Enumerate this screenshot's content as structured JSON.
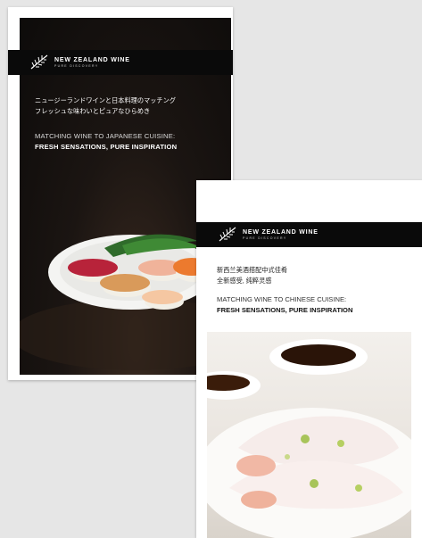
{
  "brand": {
    "name": "NEW ZEALAND WINE",
    "tagline": "PURE DISCOVERY"
  },
  "japanese_brochure": {
    "headline_jp_line1": "ニュージーランドワインと日本料理のマッチング",
    "headline_jp_line2": "フレッシュな味わいとピュアなひらめき",
    "title_line1": "MATCHING WINE TO JAPANESE CUISINE:",
    "title_line2": "FRESH SENSATIONS, PURE INSPIRATION",
    "image_subject": "sushi-plate"
  },
  "chinese_brochure": {
    "headline_cn_line1": "新西兰美酒搭配中式佳肴",
    "headline_cn_line2": "全新感受, 纯粹灵感",
    "title_line1": "MATCHING WINE TO CHINESE CUISINE:",
    "title_line2": "FRESH SENSATIONS, PURE INSPIRATION",
    "image_subject": "rice-noodle-rolls"
  },
  "colors": {
    "background": "#e6e6e6",
    "band": "#0a0a0a",
    "jp_panel": "#0d0b0a"
  },
  "icons": [
    "silver-fern-icon"
  ]
}
